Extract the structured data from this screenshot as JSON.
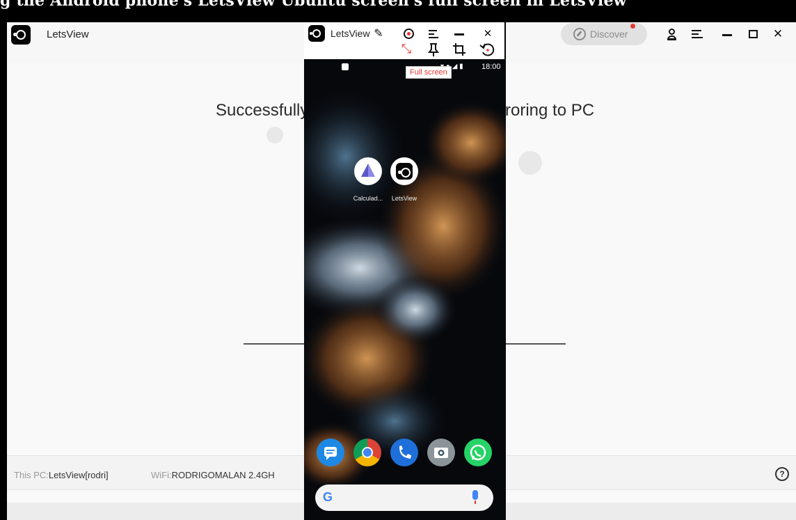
{
  "top_strip": {
    "text": "g the Android phone's LetsView Ubuntu screen's full screen in LetsView"
  },
  "app": {
    "title": "LetsView",
    "discover_label": "Discover",
    "headline_left": "Successfully",
    "headline_right": "roring to PC",
    "status": {
      "pc_label": "This PC:",
      "pc_value": "LetsView[rodri]",
      "wifi_label": "WiFi:",
      "wifi_value": "RODRIGOMALAN 2.4GH"
    },
    "help_symbol": "?"
  },
  "mirror": {
    "title": "LetsView",
    "tooltip": "Full screen",
    "phone": {
      "time": "18:00",
      "apps": [
        {
          "label": "Calculad..."
        },
        {
          "label": "LetsView"
        }
      ],
      "dock": [
        "messages-icon",
        "chrome-icon",
        "phone-icon",
        "camera-icon",
        "whatsapp-icon"
      ],
      "search_letter": "G"
    }
  },
  "colors": {
    "accent_red": "#e53935",
    "discover_bg": "#e1e1e1",
    "app_bg": "#f9f9f9"
  }
}
